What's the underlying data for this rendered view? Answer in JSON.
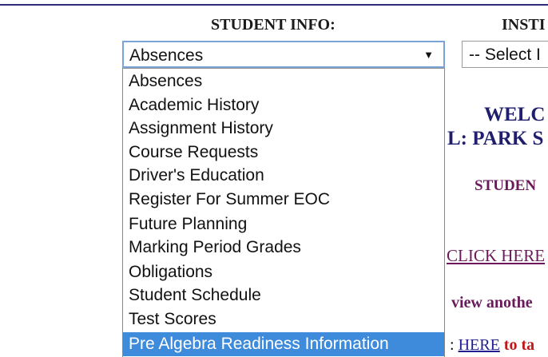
{
  "headings": {
    "student_info": "STUDENT INFO:",
    "inst": "INSTI"
  },
  "student_select": {
    "value": "Absences",
    "arrow": "▼",
    "options": [
      "Absences",
      "Academic History",
      "Assignment History",
      "Course Requests",
      "Driver's Education",
      "Register For Summer EOC",
      "Future Planning",
      "Marking Period Grades",
      "Obligations",
      "Student Schedule",
      "Test Scores",
      "Pre Algebra Readiness Information"
    ],
    "highlighted_index": 11
  },
  "inst_select": {
    "value": "-- Select I"
  },
  "welcome": {
    "line1": "WELC",
    "line2": "L: PARK S",
    "student_label": "STUDEN"
  },
  "links": {
    "click_here": "CLICK HERE",
    "view_another": "view anothe",
    "prefix": ": ",
    "here": "HERE",
    "here_rest": " to ta"
  },
  "colors": {
    "highlight": "#3f8bdb",
    "select_border": "#7aa5d6",
    "heading_blue": "#1f1f6e",
    "purple": "#6a1a5a",
    "red": "#c01818"
  }
}
